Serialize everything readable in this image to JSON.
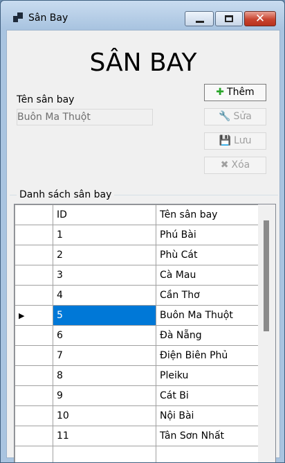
{
  "window": {
    "title": "Sân Bay"
  },
  "form": {
    "heading": "SÂN BAY",
    "name_label": "Tên sân bay",
    "name_value": "Buôn Ma Thuột"
  },
  "buttons": {
    "add": "Thêm",
    "edit": "Sửa",
    "save": "Lưu",
    "delete": "Xóa"
  },
  "list": {
    "group_title": "Danh sách sân bay",
    "columns": [
      "",
      "ID",
      "Tên sân bay"
    ],
    "rows": [
      {
        "indicator": "",
        "id": "1",
        "name": "Phú Bài"
      },
      {
        "indicator": "",
        "id": "2",
        "name": "Phù Cát"
      },
      {
        "indicator": "",
        "id": "3",
        "name": "Cà Mau"
      },
      {
        "indicator": "",
        "id": "4",
        "name": "Cần Thơ"
      },
      {
        "indicator": "▶",
        "id": "5",
        "name": "Buôn Ma Thuột",
        "selected": true
      },
      {
        "indicator": "",
        "id": "6",
        "name": "Đà Nẵng"
      },
      {
        "indicator": "",
        "id": "7",
        "name": "Điện Biên Phủ"
      },
      {
        "indicator": "",
        "id": "8",
        "name": "Pleiku"
      },
      {
        "indicator": "",
        "id": "9",
        "name": "Cát Bi"
      },
      {
        "indicator": "",
        "id": "10",
        "name": "Nội Bài"
      },
      {
        "indicator": "",
        "id": "11",
        "name": "Tân Sơn Nhất"
      }
    ]
  },
  "colors": {
    "selection": "#0078d7",
    "add_icon": "#2aa52a"
  }
}
